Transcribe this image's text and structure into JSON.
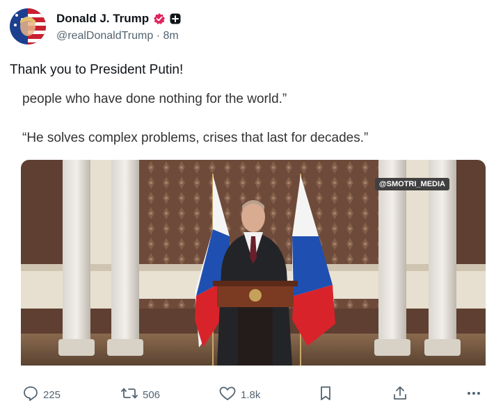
{
  "author": {
    "display_name": "Donald J. Trump",
    "handle": "@realDonaldTrump",
    "separator": "·",
    "time_ago": "8m"
  },
  "post": {
    "text": "Thank you to President Putin!"
  },
  "media": {
    "caption_line_1": "people who have done nothing for the world.”",
    "caption_line_2": "“He solves complex problems, crises that last for decades.”",
    "watermark": "@SMOTRI_MEDIA"
  },
  "actions": {
    "replies": "225",
    "reposts": "506",
    "likes": "1.8k"
  },
  "colors": {
    "verified_badge": "#e0245e",
    "secondary_text": "#536471",
    "flag_white": "#f4f4f4",
    "flag_blue": "#1f4fb0",
    "flag_red": "#d8232a"
  },
  "icons": [
    "reply-icon",
    "repost-icon",
    "like-icon",
    "bookmark-icon",
    "share-icon",
    "more-icon",
    "verified-icon",
    "plus-badge-icon"
  ]
}
